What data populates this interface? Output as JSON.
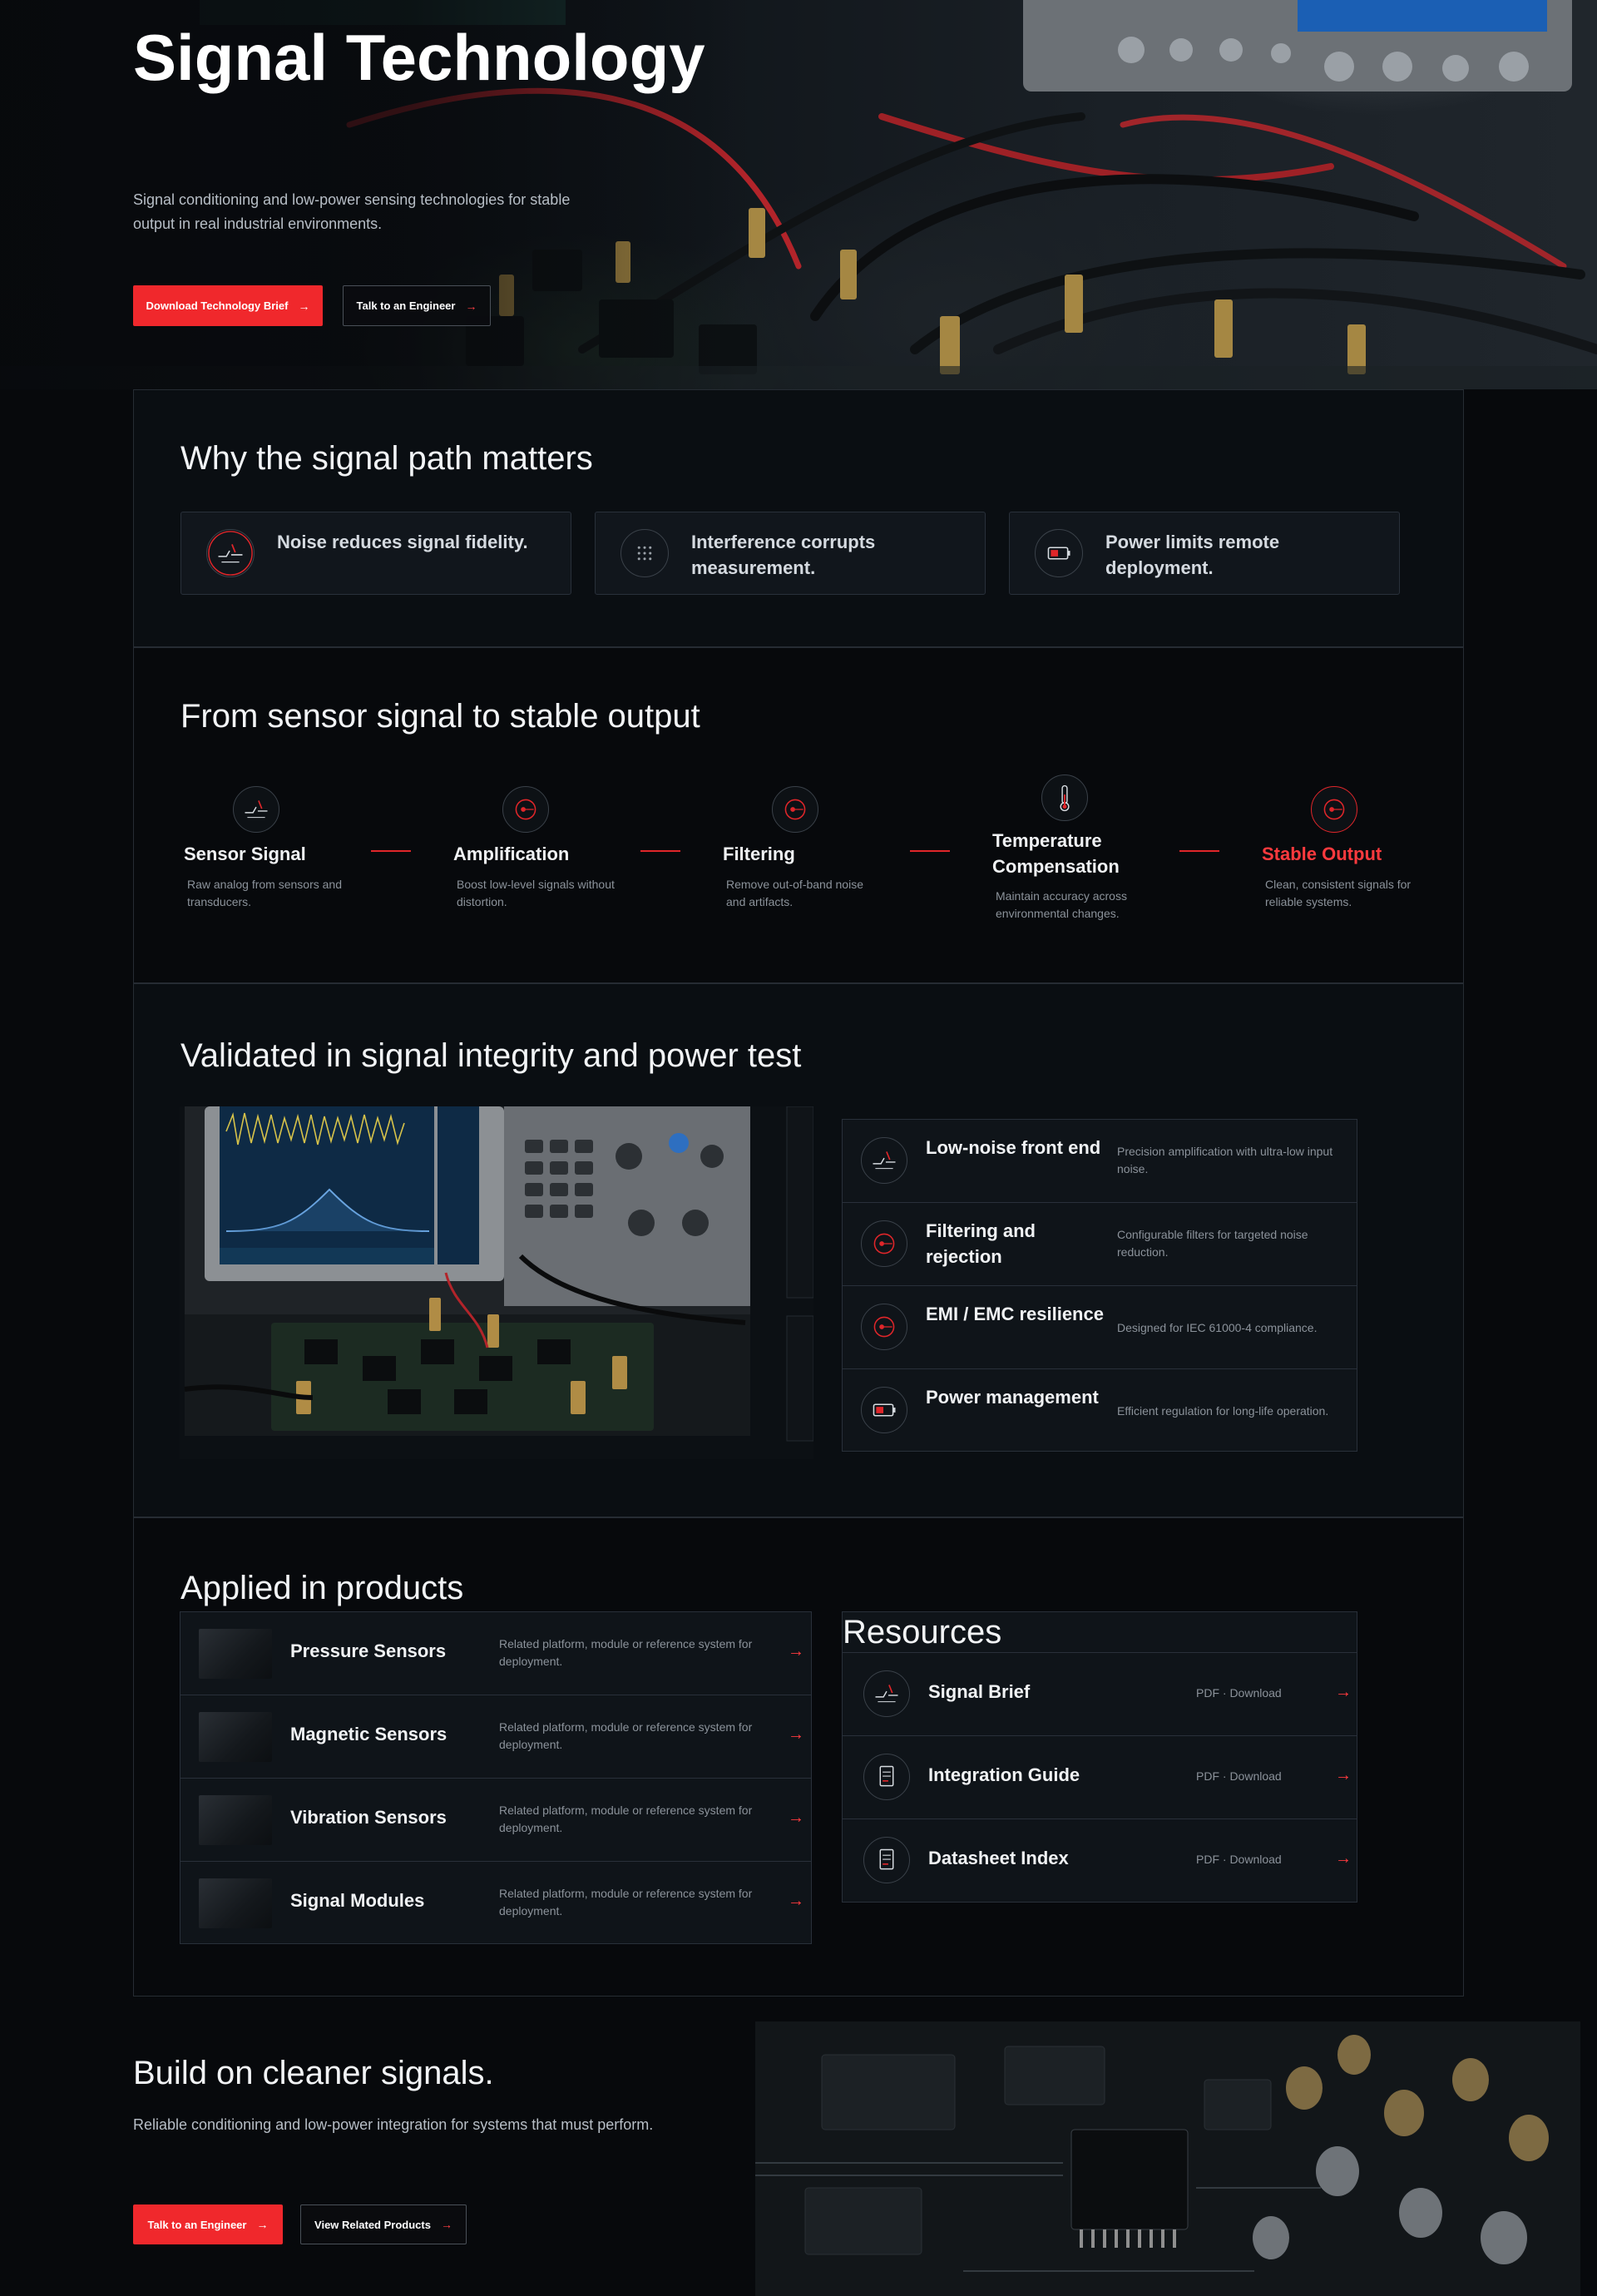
{
  "hero": {
    "title": "Signal Technology",
    "subtitle": "Signal conditioning and low-power sensing technologies for stable output in real industrial environments.",
    "primary_button": "Download Technology Brief",
    "secondary_button": "Talk to an Engineer"
  },
  "why": {
    "title": "Why the signal path matters",
    "cards": [
      {
        "text": "Noise reduces signal fidelity.",
        "icon": "noise-icon"
      },
      {
        "text": "Interference corrupts measurement.",
        "icon": "interference-grid-icon"
      },
      {
        "text": "Power limits remote deployment.",
        "icon": "battery-low-icon"
      }
    ]
  },
  "pipeline": {
    "title": "From sensor signal to stable output",
    "steps": [
      {
        "name": "Sensor Signal",
        "desc": "Raw analog from sensors and transducers."
      },
      {
        "name": "Amplification",
        "desc": "Boost low-level signals without distortion."
      },
      {
        "name": "Filtering",
        "desc": "Remove out-of-band noise and artifacts."
      },
      {
        "name": "Temperature Compensation",
        "desc": "Maintain accuracy across environmental changes."
      },
      {
        "name": "Stable Output",
        "desc": "Clean, consistent signals for reliable systems."
      }
    ]
  },
  "validated": {
    "title": "Validated in signal integrity and power test",
    "features": [
      {
        "name": "Low-noise front end",
        "desc": "Precision amplification with ultra-low input noise."
      },
      {
        "name": "Filtering and rejection",
        "desc": "Configurable filters for targeted noise reduction."
      },
      {
        "name": "EMI / EMC resilience",
        "desc": "Designed for IEC 61000-4 compliance."
      },
      {
        "name": "Power management",
        "desc": "Efficient regulation for long-life operation."
      }
    ]
  },
  "products": {
    "title": "Applied in products",
    "items": [
      {
        "name": "Pressure Sensors",
        "desc": "Related platform, module or reference system for deployment."
      },
      {
        "name": "Magnetic Sensors",
        "desc": "Related platform, module or reference system for deployment."
      },
      {
        "name": "Vibration Sensors",
        "desc": "Related platform, module or reference system for deployment."
      },
      {
        "name": "Signal Modules",
        "desc": "Related platform, module or reference system for deployment."
      }
    ]
  },
  "resources": {
    "title": "Resources",
    "items": [
      {
        "name": "Signal Brief",
        "meta": "PDF  ·  Download"
      },
      {
        "name": "Integration Guide",
        "meta": "PDF  ·  Download"
      },
      {
        "name": "Datasheet Index",
        "meta": "PDF  ·  Download"
      }
    ]
  },
  "cta": {
    "title": "Build on cleaner signals.",
    "subtitle": "Reliable conditioning and low-power integration for systems that must perform.",
    "primary_button": "Talk to an Engineer",
    "secondary_button": "View Related Products"
  },
  "colors": {
    "accent": "#f0282c",
    "background": "#07090c",
    "panel": "#0f1419",
    "border": "#29303a"
  }
}
